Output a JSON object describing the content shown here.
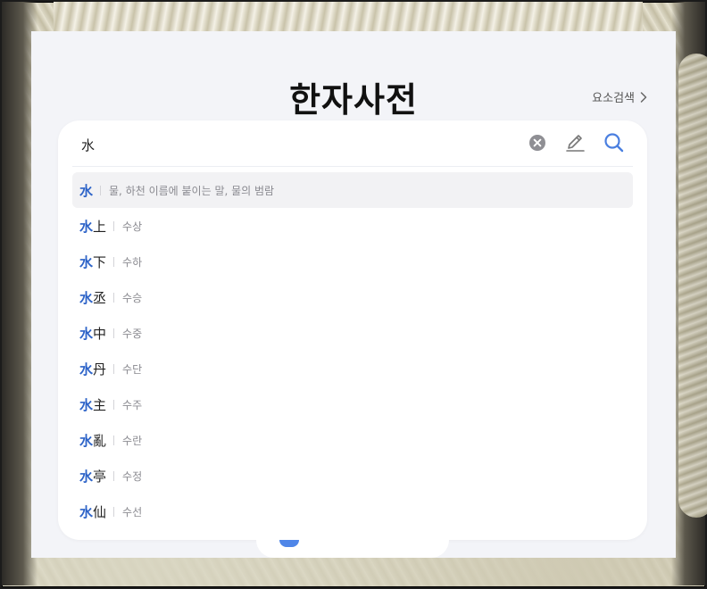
{
  "page": {
    "title": "한자사전"
  },
  "header": {
    "element_search_label": "요소검색"
  },
  "search": {
    "value": "水"
  },
  "suggestions": [
    {
      "prefix": "水",
      "rest": "",
      "reading": "물, 하천 이름에 붙이는 말, 물의 범람",
      "selected": true
    },
    {
      "prefix": "水",
      "rest": "上",
      "reading": "수상"
    },
    {
      "prefix": "水",
      "rest": "下",
      "reading": "수하"
    },
    {
      "prefix": "水",
      "rest": "丞",
      "reading": "수승"
    },
    {
      "prefix": "水",
      "rest": "中",
      "reading": "수중"
    },
    {
      "prefix": "水",
      "rest": "丹",
      "reading": "수단"
    },
    {
      "prefix": "水",
      "rest": "主",
      "reading": "수주"
    },
    {
      "prefix": "水",
      "rest": "亂",
      "reading": "수란"
    },
    {
      "prefix": "水",
      "rest": "亭",
      "reading": "수정"
    },
    {
      "prefix": "水",
      "rest": "仙",
      "reading": "수선"
    }
  ],
  "colors": {
    "accent": "#2e64c8",
    "search_icon": "#4a7fe0",
    "panel_bg": "#f3f4f8"
  },
  "icons": {
    "clear": "clear-circle-icon",
    "handwriting": "pen-icon",
    "search": "search-icon",
    "element_search_arrow": "chevron-right-icon"
  }
}
